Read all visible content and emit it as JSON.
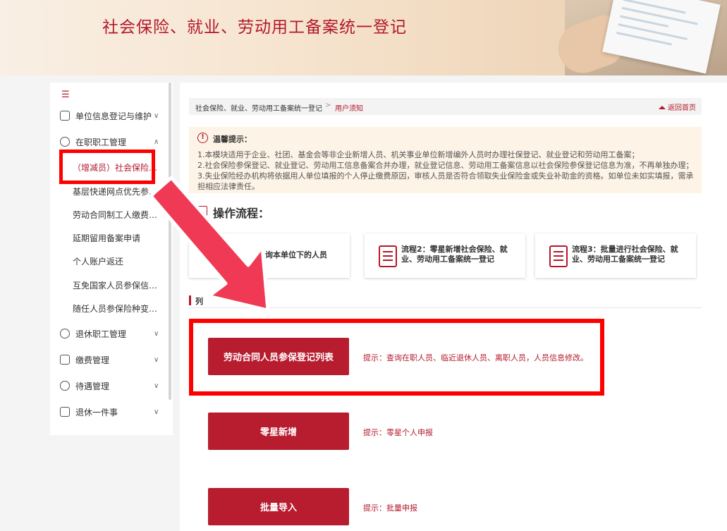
{
  "banner": {
    "title": "社会保险、就业、劳动用工备案统一登记"
  },
  "sidebar": {
    "toggle_icon": "menu-collapse-icon",
    "items": [
      {
        "label": "单位信息登记与维护",
        "icon": "building-icon",
        "expanded": false
      },
      {
        "label": "在职职工管理",
        "icon": "user-group-icon",
        "expanded": true,
        "children": [
          {
            "label": "（增减员）社会保险、就业...",
            "active": true
          },
          {
            "label": "基层快递网点优先参加工伤..."
          },
          {
            "label": "劳动合同制工人缴费年限..."
          },
          {
            "label": "延期留用备案申请"
          },
          {
            "label": "个人账户返还"
          },
          {
            "label": "互免国家人员参保信息..."
          },
          {
            "label": "随任人员参保险种变更..."
          }
        ]
      },
      {
        "label": "退休职工管理",
        "icon": "retire-icon",
        "expanded": false
      },
      {
        "label": "缴费管理",
        "icon": "payment-icon",
        "expanded": false
      },
      {
        "label": "待遇管理",
        "icon": "benefit-icon",
        "expanded": false
      },
      {
        "label": "退休一件事",
        "icon": "case-icon",
        "expanded": false
      }
    ]
  },
  "breadcrumb": {
    "level1": "社会保险、就业、劳动用工备案统一登记",
    "separator": ">",
    "level2": "用户须知",
    "home_link": "返回首页"
  },
  "notice": {
    "title": "温馨提示：",
    "lines": [
      "1.本模块适用于企业、社团、基金会等非企业新增人员、机关事业单位新增编外人员时办理社保登记、就业登记和劳动用工备案；",
      "2.社会保险参保登记、就业登记、劳动用工信息备案合并办理，就业登记信息、劳动用工备案信息以社会保险参保登记信息为准，不再单独办理；",
      "3.失业保险经办机构将依据用人单位填报的个人停止缴费原因，审核人员是否符合领取失业保险金或失业补助金的资格。如单位未如实填报，需承担相应法律责任。"
    ]
  },
  "flow": {
    "title": "操作流程：",
    "cards": [
      {
        "text": "询本单位下的人员"
      },
      {
        "text": "流程2：零星新增社会保险、就业、劳动用工备案统一登记"
      },
      {
        "text": "流程3：批量进行社会保险、就业、劳动用工备案统一登记"
      }
    ]
  },
  "section": {
    "title": "列"
  },
  "actions": [
    {
      "label": "劳动合同人员参保登记列表",
      "hint": "提示：查询在职人员、临近退休人员、离职人员，人员信息修改。"
    },
    {
      "label": "零星新增",
      "hint": "提示：零星个人申报"
    },
    {
      "label": "批量导入",
      "hint": "提示：批量申报"
    }
  ],
  "colors": {
    "brand_red": "#b71c2f",
    "annotation_red": "#ff0000",
    "arrow_pink": "#f03a55"
  }
}
